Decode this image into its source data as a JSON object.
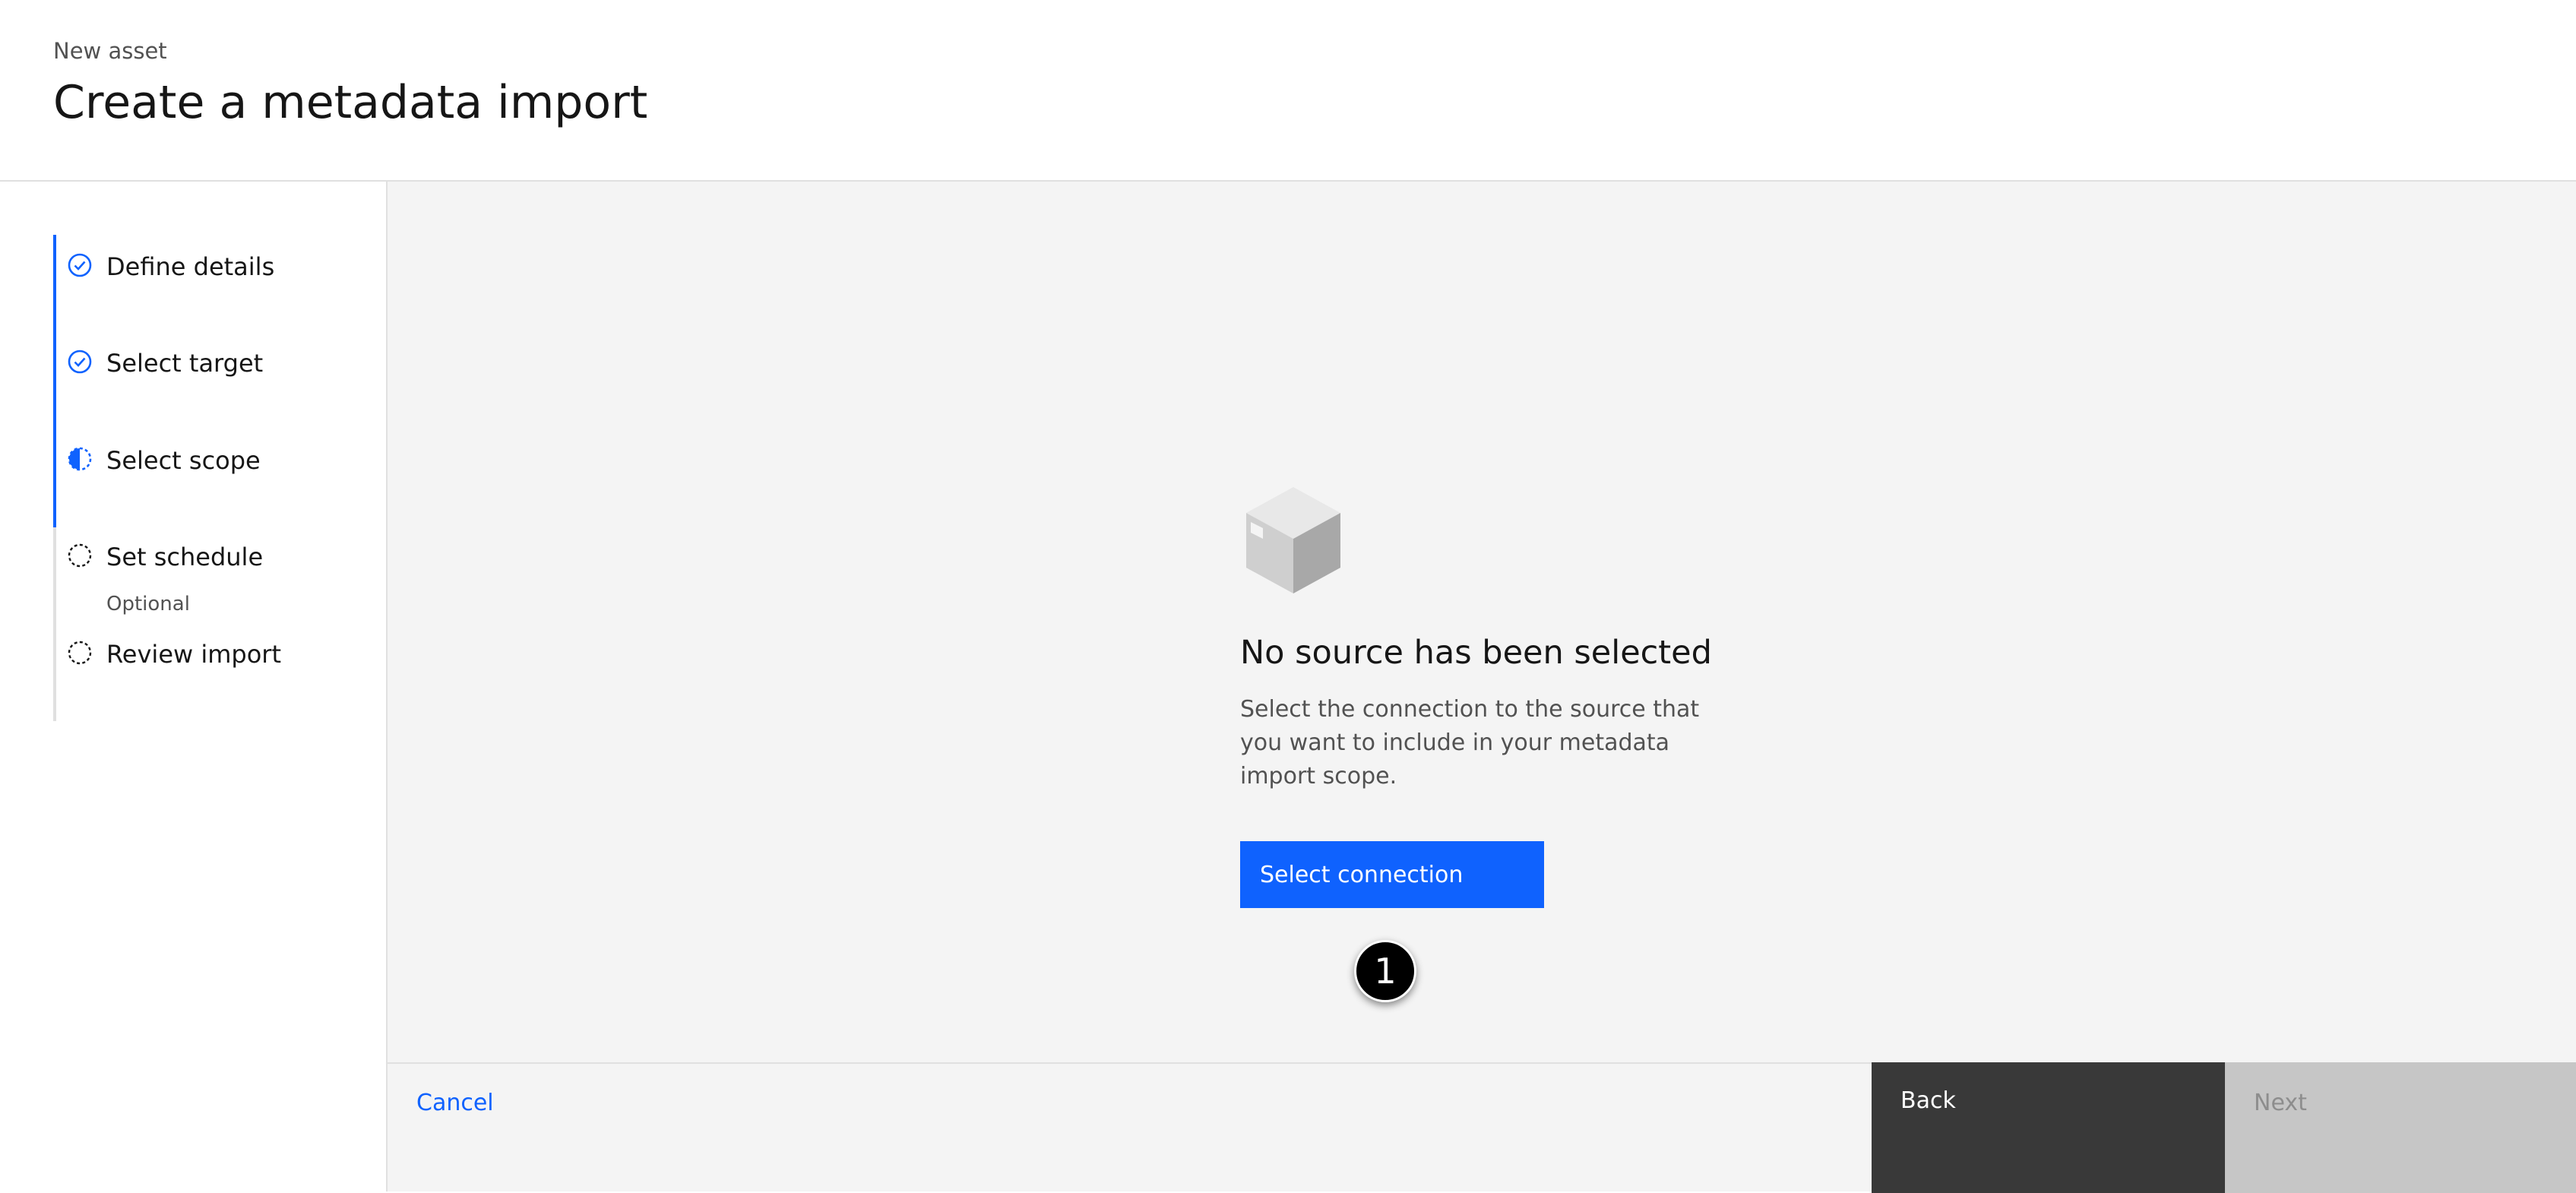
{
  "header": {
    "eyebrow": "New asset",
    "title": "Create a metadata import"
  },
  "progress": {
    "steps": [
      {
        "label": "Define details",
        "status": "complete",
        "icon": "checkmark-outline-icon"
      },
      {
        "label": "Select target",
        "status": "complete",
        "icon": "checkmark-outline-icon"
      },
      {
        "label": "Select scope",
        "status": "current",
        "icon": "incomplete-half-icon"
      },
      {
        "label": "Set schedule",
        "sublabel": "Optional",
        "status": "incomplete",
        "icon": "circle-dash-icon"
      },
      {
        "label": "Review import",
        "status": "incomplete",
        "icon": "circle-dash-icon"
      }
    ]
  },
  "empty_state": {
    "illustration": "box-icon",
    "title": "No source has been selected",
    "description": "Select the connection to the source that you want to include in your metadata import scope.",
    "button_label": "Select connection"
  },
  "callout": {
    "number": "1"
  },
  "footer": {
    "cancel_label": "Cancel",
    "back_label": "Back",
    "next_label": "Next"
  },
  "colors": {
    "accent": "#0f62fe",
    "main_bg": "#f4f4f4",
    "back_bg": "#393939",
    "next_disabled_bg": "#c6c6c6"
  }
}
